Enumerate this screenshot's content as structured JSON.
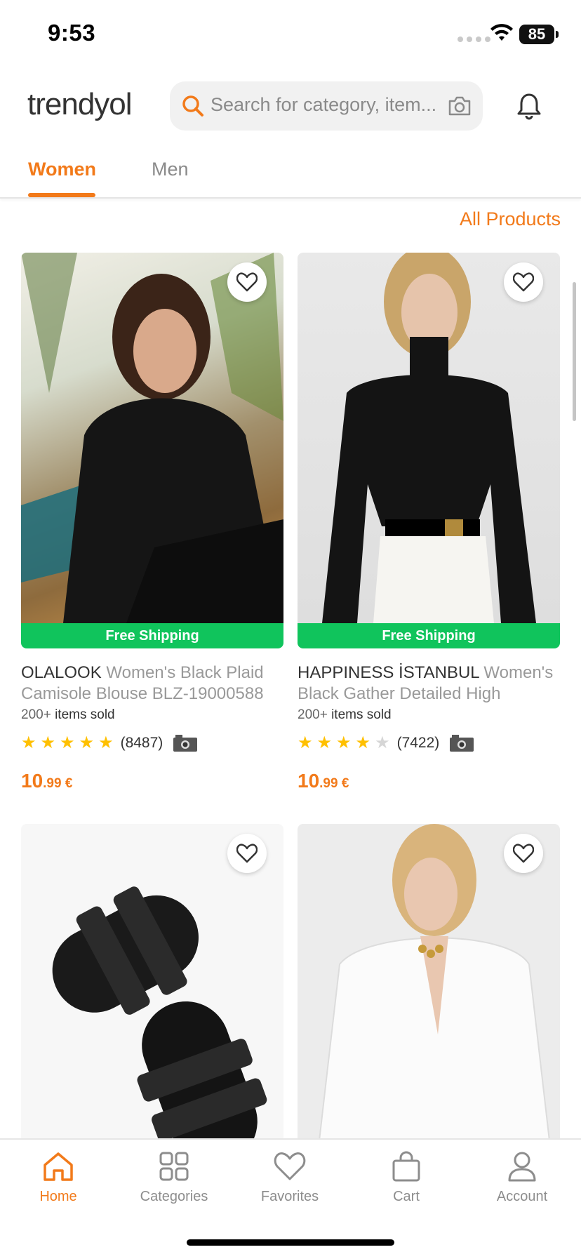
{
  "status_bar": {
    "time": "9:53",
    "battery": "85"
  },
  "header": {
    "logo": "trendyol",
    "search_placeholder": "Search for category, item..."
  },
  "tabs": [
    {
      "label": "Women",
      "active": true
    },
    {
      "label": "Men",
      "active": false
    }
  ],
  "all_products_link": "All Products",
  "products": [
    {
      "brand": "OLALOOK",
      "title": "Women's Black Plaid Camisole Blouse BLZ-19000588",
      "badge": "Free Shipping",
      "sold_prefix": "200+",
      "sold_suffix": "items sold",
      "rating": 5,
      "review_count": "(8487)",
      "price_int": "10",
      "price_dec": ".99 €"
    },
    {
      "brand": "HAPPINESS İSTANBUL",
      "title": "Women's Black Gather Detailed High Collar...",
      "badge": "Free Shipping",
      "sold_prefix": "200+",
      "sold_suffix": "items sold",
      "rating": 4,
      "review_count": "(7422)",
      "price_int": "10",
      "price_dec": ".99 €"
    }
  ],
  "bottom_nav": [
    {
      "label": "Home",
      "icon": "home-icon",
      "active": true
    },
    {
      "label": "Categories",
      "icon": "grid-icon",
      "active": false
    },
    {
      "label": "Favorites",
      "icon": "heart-icon",
      "active": false
    },
    {
      "label": "Cart",
      "icon": "bag-icon",
      "active": false
    },
    {
      "label": "Account",
      "icon": "user-icon",
      "active": false
    }
  ],
  "colors": {
    "accent": "#f27a1a",
    "shipping": "#10c45c",
    "star": "#ffc000"
  }
}
